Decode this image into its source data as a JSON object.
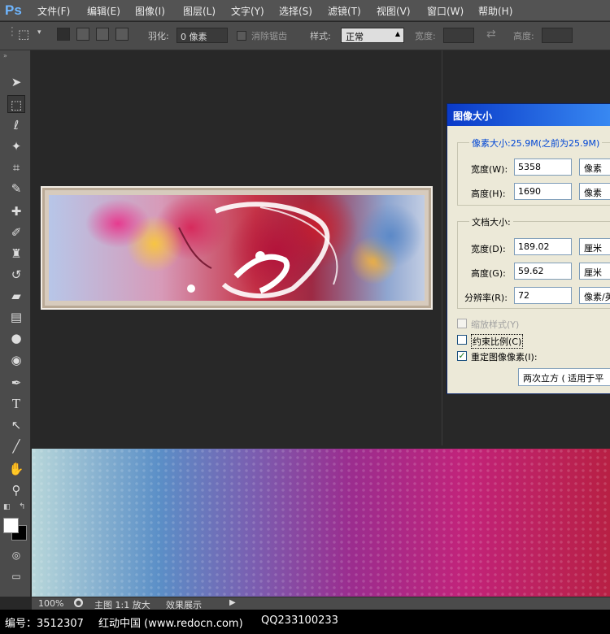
{
  "menubar": {
    "logo": "Ps",
    "items": [
      "文件(F)",
      "编辑(E)",
      "图像(I)",
      "图层(L)",
      "文字(Y)",
      "选择(S)",
      "滤镜(T)",
      "视图(V)",
      "窗口(W)",
      "帮助(H)"
    ]
  },
  "options": {
    "feather_label": "羽化:",
    "feather_value": "0 像素",
    "antialias_label": "消除锯齿",
    "style_label": "样式:",
    "style_value": "正常",
    "width_label": "宽度:",
    "height_label": "高度:"
  },
  "dialog": {
    "title": "图像大小",
    "pixel_size_label": "像素大小:25.9M(之前为25.9M)",
    "pixel_width_label": "宽度(W):",
    "pixel_width_value": "5358",
    "pixel_width_unit": "像素",
    "pixel_height_label": "高度(H):",
    "pixel_height_value": "1690",
    "pixel_height_unit": "像素",
    "doc_size_label": "文档大小:",
    "doc_width_label": "宽度(D):",
    "doc_width_value": "189.02",
    "doc_width_unit": "厘米",
    "doc_height_label": "高度(G):",
    "doc_height_value": "59.62",
    "doc_height_unit": "厘米",
    "resolution_label": "分辨率(R):",
    "resolution_value": "72",
    "resolution_unit": "像素/英",
    "scale_styles_label": "缩放样式(Y)",
    "constrain_label": "约束比例(C)",
    "resample_label": "重定图像像素(I):",
    "resample_method": "两次立方 ( 适用于平"
  },
  "statusbar": {
    "zoom": "100%",
    "tab_main": "主图 1:1 放大",
    "tab_effect": "效果展示"
  },
  "footer": {
    "id_text": "编号：3512307",
    "site": "红动中国 (www.redocn.com)",
    "qq": "QQ233100233"
  },
  "colors": {
    "accent": "#0a3ac8",
    "ui_bg": "#535353",
    "canvas_bg": "#282828"
  }
}
